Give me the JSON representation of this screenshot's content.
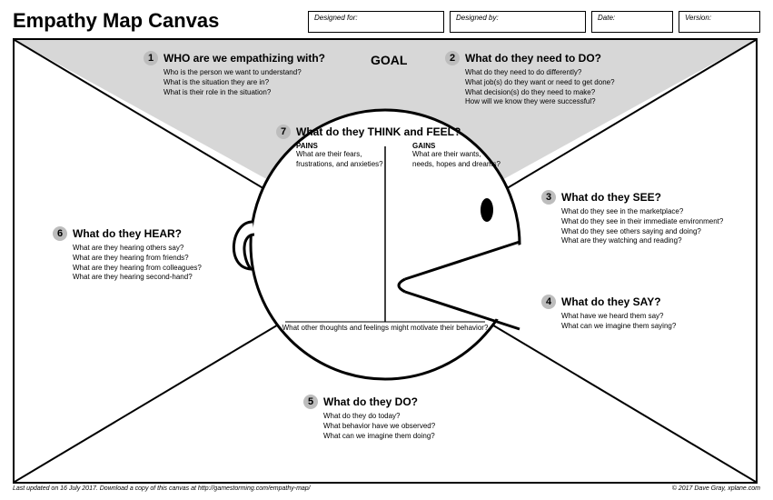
{
  "title": "Empathy Map Canvas",
  "meta": {
    "designed_for": "Designed for:",
    "designed_by": "Designed by:",
    "date": "Date:",
    "version": "Version:"
  },
  "goal_label": "GOAL",
  "sections": {
    "s1": {
      "num": "1",
      "title": "WHO are we empathizing with?",
      "lines": [
        "Who is the person we want to understand?",
        "What is the situation they are in?",
        "What is their role in the situation?"
      ]
    },
    "s2": {
      "num": "2",
      "title": "What do they need to DO?",
      "lines": [
        "What do they need to do differently?",
        "What job(s) do they want or need to get done?",
        "What decision(s) do they need to make?",
        "How will we know they were successful?"
      ]
    },
    "s3": {
      "num": "3",
      "title": "What do they SEE?",
      "lines": [
        "What do they see in the marketplace?",
        "What do they see in their immediate environment?",
        "What do they see others saying and doing?",
        "What are they watching and reading?"
      ]
    },
    "s4": {
      "num": "4",
      "title": "What do they SAY?",
      "lines": [
        "What have we heard them say?",
        "What can we imagine them saying?"
      ]
    },
    "s5": {
      "num": "5",
      "title": "What do they DO?",
      "lines": [
        "What do they do today?",
        "What behavior have we observed?",
        "What can we imagine them doing?"
      ]
    },
    "s6": {
      "num": "6",
      "title": "What do they HEAR?",
      "lines": [
        "What are they hearing others say?",
        "What are they hearing from friends?",
        "What are they hearing from colleagues?",
        "What are they hearing second-hand?"
      ]
    },
    "s7": {
      "num": "7",
      "title": "What do they THINK and FEEL?",
      "pains_label": "PAINS",
      "pains_lines": [
        "What are their fears,",
        "frustrations, and anxieties?"
      ],
      "gains_label": "GAINS",
      "gains_lines": [
        "What are their wants,",
        "needs, hopes and dreams?"
      ]
    }
  },
  "motivate": "What other thoughts and feelings might motivate their behavior?",
  "footer_left": "Last updated on 16 July 2017. Download a copy of this canvas at http://gamestorming.com/empathy-map/",
  "footer_right": "© 2017 Dave Gray, xplane.com"
}
